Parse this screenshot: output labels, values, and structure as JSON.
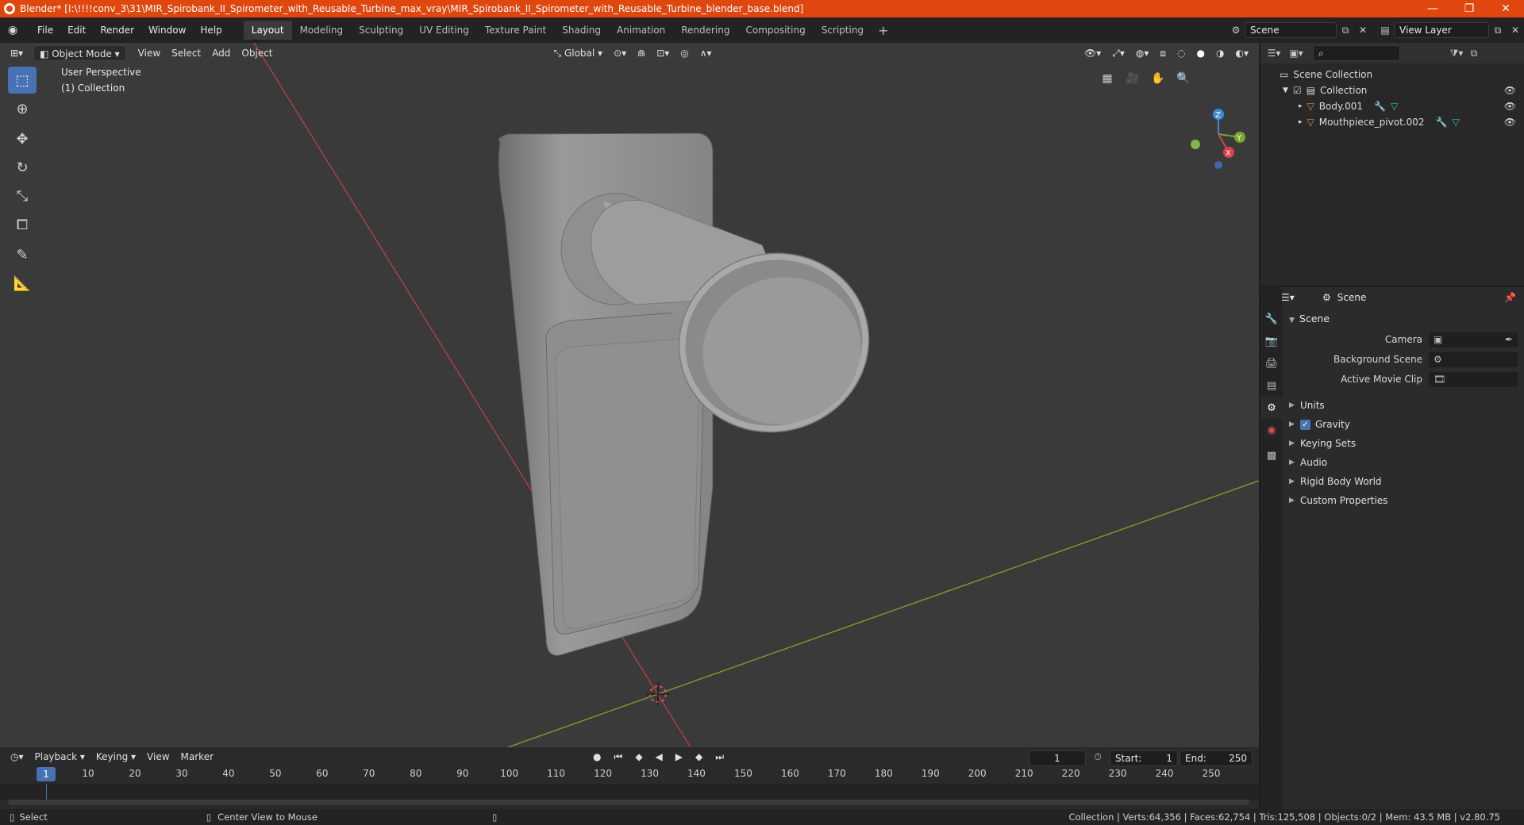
{
  "window": {
    "title": "Blender* [I:\\!!!!conv_3\\31\\MIR_Spirobank_II_Spirometer_with_Reusable_Turbine_max_vray\\MIR_Spirobank_II_Spirometer_with_Reusable_Turbine_blender_base.blend]",
    "minimize": "—",
    "maximize": "❐",
    "close": "✕"
  },
  "menus": [
    "File",
    "Edit",
    "Render",
    "Window",
    "Help"
  ],
  "workspaces": [
    "Layout",
    "Modeling",
    "Sculpting",
    "UV Editing",
    "Texture Paint",
    "Shading",
    "Animation",
    "Rendering",
    "Compositing",
    "Scripting"
  ],
  "workspace_active": "Layout",
  "scene_field": "Scene",
  "view_layer_field": "View Layer",
  "viewport": {
    "mode": "Object Mode",
    "menus": [
      "View",
      "Select",
      "Add",
      "Object"
    ],
    "transform_orientation": "Global",
    "overlay_line1": "User Perspective",
    "overlay_line2": "(1) Collection",
    "gizmo": {
      "x": "X",
      "y": "Y",
      "z": "Z"
    }
  },
  "outliner": {
    "root": "Scene Collection",
    "collection": "Collection",
    "items": [
      "Body.001",
      "Mouthpiece_pivot.002"
    ]
  },
  "properties": {
    "header": "Scene",
    "section": "Scene",
    "rows": [
      {
        "label": "Camera"
      },
      {
        "label": "Background Scene"
      },
      {
        "label": "Active Movie Clip"
      }
    ],
    "panels": [
      "Units",
      "Gravity",
      "Keying Sets",
      "Audio",
      "Rigid Body World",
      "Custom Properties"
    ]
  },
  "timeline": {
    "menus": [
      "Playback",
      "Keying",
      "View",
      "Marker"
    ],
    "current_frame": "1",
    "start_label": "Start:",
    "start": "1",
    "end_label": "End:",
    "end": "250",
    "ruler": [
      "1",
      "10",
      "20",
      "30",
      "40",
      "50",
      "60",
      "70",
      "80",
      "90",
      "100",
      "110",
      "120",
      "130",
      "140",
      "150",
      "160",
      "170",
      "180",
      "190",
      "200",
      "210",
      "220",
      "230",
      "240",
      "250"
    ]
  },
  "status": {
    "left": "Select",
    "middle": "Center View to Mouse",
    "right": "Collection | Verts:64,356 | Faces:62,754 | Tris:125,508 | Objects:0/2 | Mem: 43.5 MB | v2.80.75"
  },
  "colors": {
    "titlebar": "#e0470f",
    "accent": "#4772b3",
    "viewport_bg": "#3a3a3a",
    "x_axis": "#c7414b",
    "y_axis": "#7fa52e"
  }
}
